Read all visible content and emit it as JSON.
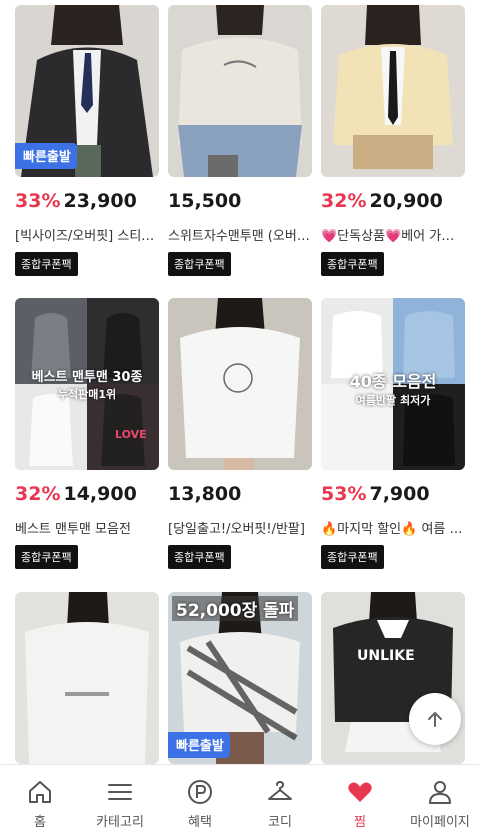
{
  "colors": {
    "accent": "#e8384f",
    "fast_badge": "#3d72e6",
    "coupon_bg": "#111111"
  },
  "products": [
    {
      "discount": "33%",
      "price": "23,900",
      "title": "[빅사이즈/오버핏] 스티치 가디건",
      "coupon": "종합쿠폰팩",
      "badge": "빠른출발",
      "caption": "",
      "caption_sub": ""
    },
    {
      "discount": "",
      "price": "15,500",
      "title": "스위트자수맨투맨 (오버핏)",
      "coupon": "종합쿠폰팩",
      "badge": "",
      "caption": "",
      "caption_sub": ""
    },
    {
      "discount": "32%",
      "price": "20,900",
      "title": "💗단독상품💗베어 가디건",
      "coupon": "종합쿠폰팩",
      "badge": "",
      "caption": "",
      "caption_sub": ""
    },
    {
      "discount": "32%",
      "price": "14,900",
      "title": "베스트 맨투맨 모음전",
      "coupon": "종합쿠폰팩",
      "badge": "",
      "caption": "베스트 맨투맨 30종",
      "caption_sub": "누적판매1위"
    },
    {
      "discount": "",
      "price": "13,800",
      "title": "[당일출고!/오버핏!/반팔]",
      "coupon": "종합쿠폰팩",
      "badge": "",
      "caption": "",
      "caption_sub": ""
    },
    {
      "discount": "53%",
      "price": "7,900",
      "title": "🔥마지막 할인🔥 여름 반팔",
      "coupon": "종합쿠폰팩",
      "badge": "",
      "caption": "40종 모음전",
      "caption_sub": "여름반팔 최저가"
    },
    {
      "discount": "",
      "price": "",
      "title": "",
      "coupon": "",
      "badge": "",
      "caption": "",
      "caption_sub": ""
    },
    {
      "discount": "",
      "price": "",
      "title": "",
      "coupon": "",
      "badge": "빠른출발",
      "caption": "52,000장 돌파",
      "caption_sub": ""
    },
    {
      "discount": "",
      "price": "",
      "title": "",
      "coupon": "",
      "badge": "",
      "caption": "",
      "caption_sub": ""
    }
  ],
  "nav": [
    {
      "label": "홈",
      "icon": "home-icon"
    },
    {
      "label": "카테고리",
      "icon": "menu-icon"
    },
    {
      "label": "혜택",
      "icon": "benefit-p-icon"
    },
    {
      "label": "코디",
      "icon": "hanger-icon"
    },
    {
      "label": "찜",
      "icon": "heart-icon"
    },
    {
      "label": "마이페이지",
      "icon": "user-icon"
    }
  ]
}
